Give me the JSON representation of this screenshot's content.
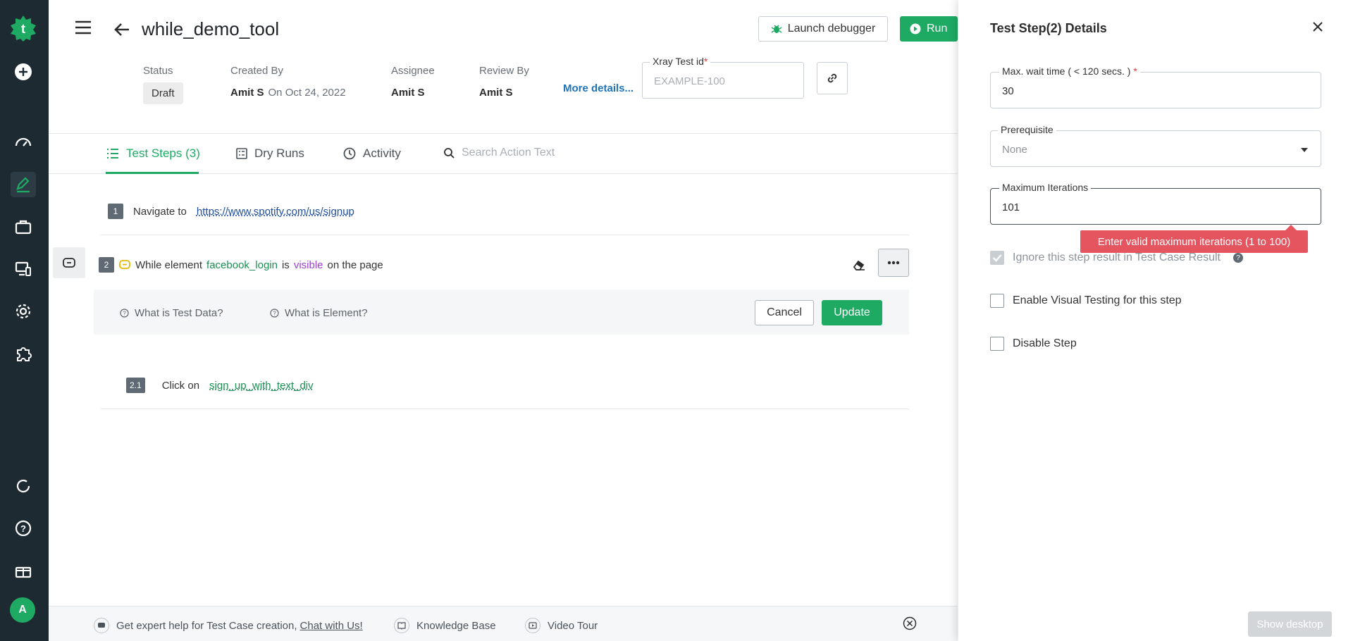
{
  "header": {
    "title": "while_demo_tool",
    "launch_debugger": "Launch debugger",
    "run": "Run"
  },
  "meta": {
    "status_label": "Status",
    "status_value": "Draft",
    "created_by_label": "Created By",
    "created_by_name": "Amit S",
    "created_on": "On Oct 24, 2022",
    "assignee_label": "Assignee",
    "assignee_value": "Amit S",
    "review_label": "Review By",
    "review_value": "Amit S",
    "more_details": "More details...",
    "xray_label": "Xray Test id",
    "xray_required": "*",
    "xray_placeholder": "EXAMPLE-100"
  },
  "tabs": [
    {
      "label": "Test Steps (3)"
    },
    {
      "label": "Dry Runs"
    },
    {
      "label": "Activity"
    }
  ],
  "search": {
    "placeholder": "Search Action Text"
  },
  "steps": [
    {
      "num": "1",
      "text": "Navigate to",
      "link": "https://www.spotify.com/us/signup"
    },
    {
      "num": "2",
      "pre": "While element",
      "element": "facebook_login",
      "is": "is",
      "cond": "visible",
      "post": "on the page"
    },
    {
      "num": "2.1",
      "text": "Click on",
      "link": "sign_up_with_text_div"
    }
  ],
  "helpbar": {
    "test_data": "What is Test Data?",
    "element": "What is Element?",
    "cancel": "Cancel",
    "update": "Update"
  },
  "footer": {
    "expert": "Get expert help for Test Case creation,",
    "chat": "Chat with Us!",
    "kb": "Knowledge Base",
    "tour": "Video Tour"
  },
  "rail": {
    "avatar": "A"
  },
  "panel": {
    "title": "Test Step(2) Details",
    "wait_label": "Max. wait time ( < 120 secs. )",
    "wait_required": "*",
    "wait_value": "30",
    "prereq_label": "Prerequisite",
    "prereq_value": "None",
    "iter_label": "Maximum Iterations",
    "iter_value": "101",
    "iter_error": "Enter valid maximum iterations (1 to 100)",
    "ignore_label": "Ignore this step result in Test Case Result",
    "visual_label": "Enable Visual Testing for this step",
    "disable_label": "Disable Step",
    "show_desktop": "Show desktop"
  },
  "colors": {
    "accent": "#1faa64",
    "rail": "#1e2a32",
    "error": "#e5555f"
  }
}
